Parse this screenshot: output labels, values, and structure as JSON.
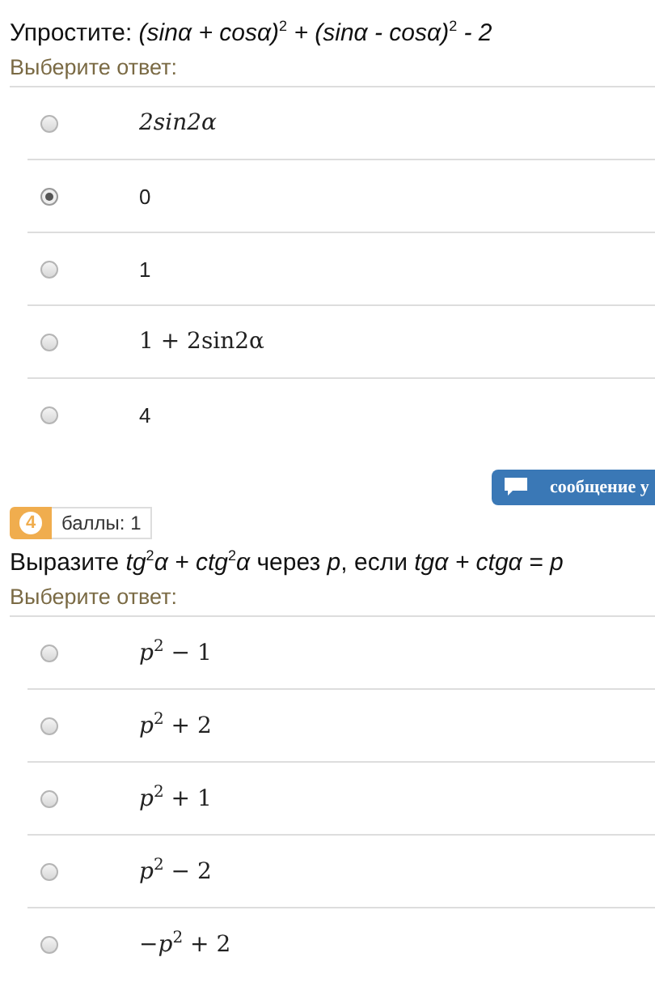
{
  "questions": [
    {
      "title": "Упростите: *(sinα + cosα)*$^{2}$ *+ (sinα - cosα)*$^{2}$ *- 2*",
      "prompt": "Выберите ответ:",
      "options": [
        {
          "kind": "math",
          "text": "*2sin2α*",
          "selected": false
        },
        {
          "kind": "plain",
          "text": "0",
          "selected": true
        },
        {
          "kind": "plain",
          "text": "1",
          "selected": false
        },
        {
          "kind": "math",
          "text": "1 + 2sin2α",
          "selected": false
        },
        {
          "kind": "plain",
          "text": "4",
          "selected": false
        }
      ]
    },
    {
      "message_button": "сообщение у",
      "number": "4",
      "points": "баллы: 1",
      "title": "Выразите *tg*$^{2}$*α + ctg*$^{2}$*α* через *p*, если *tgα + ctgα = p*",
      "prompt": "Выберите ответ:",
      "options": [
        {
          "kind": "math",
          "text": "*p*$^{2}$ − 1",
          "selected": false
        },
        {
          "kind": "math",
          "text": "*p*$^{2}$ + 2",
          "selected": false
        },
        {
          "kind": "math",
          "text": "*p*$^{2}$ + 1",
          "selected": false
        },
        {
          "kind": "math",
          "text": "*p*$^{2}$ − 2",
          "selected": false
        },
        {
          "kind": "math",
          "text": "−*p*$^{2}$ + 2",
          "selected": false
        }
      ]
    }
  ]
}
